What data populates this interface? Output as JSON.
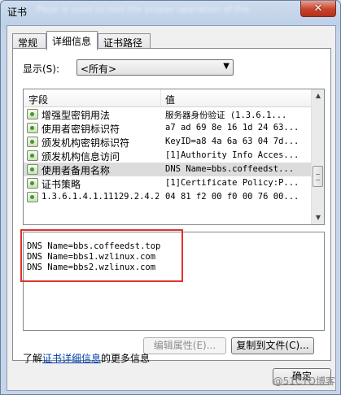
{
  "window": {
    "title": "证书",
    "blurred_title": "Page is used to test the proper operation of the",
    "close_glyph": "✕"
  },
  "tabs": [
    {
      "label": "常规"
    },
    {
      "label": "详细信息"
    },
    {
      "label": "证书路径"
    }
  ],
  "show": {
    "label": "显示(S):",
    "selected": "<所有>"
  },
  "list": {
    "columns": [
      "字段",
      "值"
    ],
    "rows": [
      {
        "field": "增强型密钥用法",
        "value": "服务器身份验证 (1.3.6.1..."
      },
      {
        "field": "使用者密钥标识符",
        "value": "a7 ad 69 8e 16 1d 24 63..."
      },
      {
        "field": "颁发机构密钥标识符",
        "value": "KeyID=a8 4a 6a 63 04 7d..."
      },
      {
        "field": "颁发机构信息访问",
        "value": "[1]Authority Info Acces..."
      },
      {
        "field": "使用者备用名称",
        "value": "DNS Name=bbs.coffeedst..."
      },
      {
        "field": "证书策略",
        "value": "[1]Certificate Policy:P..."
      },
      {
        "field": "1.3.6.1.4.1.11129.2.4.2",
        "value": "04 81 f2 00 f0 00 76 00..."
      }
    ]
  },
  "detail": {
    "lines": [
      "DNS Name=bbs.coffeedst.top",
      "DNS Name=bbs1.wzlinux.com",
      "DNS Name=bbs2.wzlinux.com"
    ]
  },
  "buttons": {
    "edit_properties": "编辑属性(E)...",
    "copy_to_file": "复制到文件(C)...",
    "ok": "确定"
  },
  "more_info": {
    "prefix": "了解",
    "link": "证书详细信息",
    "suffix": "的更多信息"
  },
  "watermark": "@51CTO博客",
  "colors": {
    "highlight_border": "#e0322b",
    "link": "#0645ad"
  }
}
